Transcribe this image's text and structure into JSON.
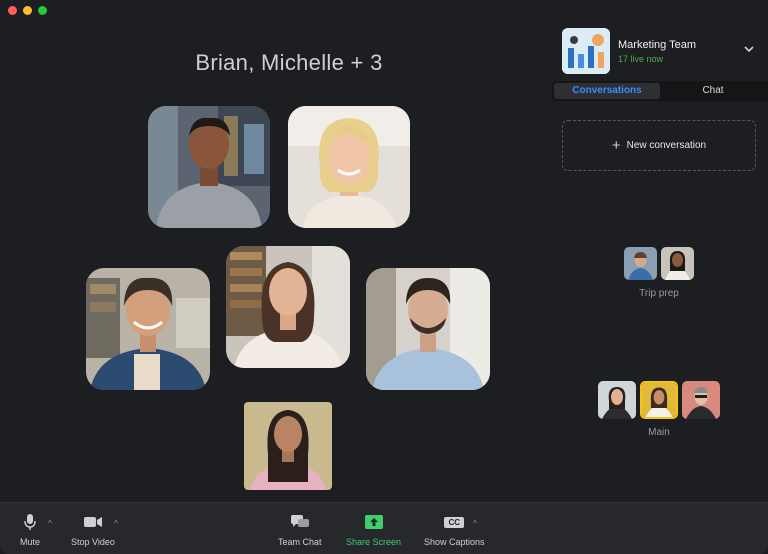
{
  "meeting": {
    "title": "Brian, Michelle + 3"
  },
  "team": {
    "name": "Marketing Team",
    "live": "17 live now"
  },
  "tabs": [
    {
      "label": "Conversations",
      "active": true
    },
    {
      "label": "Chat",
      "active": false
    }
  ],
  "new_conversation": {
    "label": "New conversation"
  },
  "groups": [
    {
      "label": "Trip prep"
    },
    {
      "label": "Main"
    }
  ],
  "toolbar": {
    "mute": "Mute",
    "stop_video": "Stop Video",
    "team_chat": "Team Chat",
    "share_screen": "Share Screen",
    "show_captions": "Show Captions",
    "cc_badge": "CC"
  },
  "colors": {
    "accent_blue": "#3d8bff",
    "live_green": "#4caf50",
    "share_green": "#3fcf6d",
    "highlight_yellow": "#f2c318"
  }
}
